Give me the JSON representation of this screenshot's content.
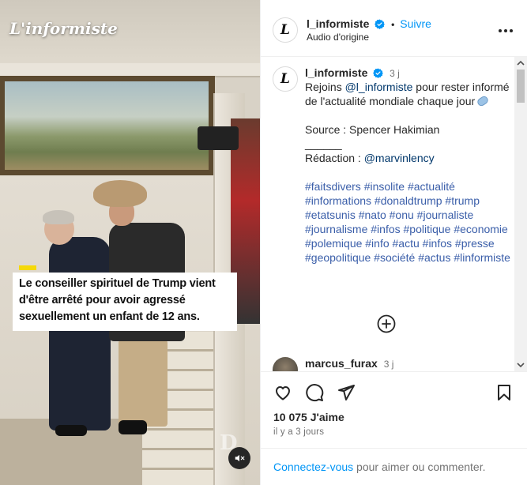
{
  "media": {
    "brand_logo": "L'informiste",
    "caption": "Le conseiller spirituel de Trump vient d'être arrêté pour avoir agressé sexuellement un enfant de 12 ans.",
    "mute_icon": "speaker-muted-icon"
  },
  "header": {
    "avatar_letter": "L",
    "username": "l_informiste",
    "dot": "•",
    "follow_label": "Suivre",
    "subtitle": "Audio d'origine",
    "more_icon": "more-horizontal-icon"
  },
  "caption_post": {
    "avatar_letter": "L",
    "username": "l_informiste",
    "time": "3 j",
    "line1_before": "Rejoins ",
    "mention1": "@l_informiste",
    "line1_after": " pour rester informé de l'actualité mondiale chaque jour",
    "source": "Source : Spencer Hakimian",
    "separator": "______",
    "redaction_label": "Rédaction : ",
    "mention2": "@marvinlency",
    "hashtags": "#faitsdivers #insolite #actualité #informations #donaldtrump #trump #etatsunis #nato #onu #journaliste #journalisme #infos #politique #economie #polemique #info #actu #infos #presse #geopolitique #société #actus #linformiste"
  },
  "next_comment": {
    "username": "marcus_furax",
    "time": "3 j"
  },
  "actions": {
    "like_icon": "heart-icon",
    "comment_icon": "comment-icon",
    "share_icon": "send-icon",
    "save_icon": "bookmark-icon",
    "likes_count": "10 075",
    "likes_label": " J'aime",
    "date": "il y a 3 jours",
    "login_link": "Connectez-vous",
    "login_rest": " pour aimer ou commenter."
  },
  "colors": {
    "accent": "#0095f6",
    "link": "#00376b",
    "hashtag": "#3a5ea9",
    "caption_highlight": "#f5d90a"
  }
}
